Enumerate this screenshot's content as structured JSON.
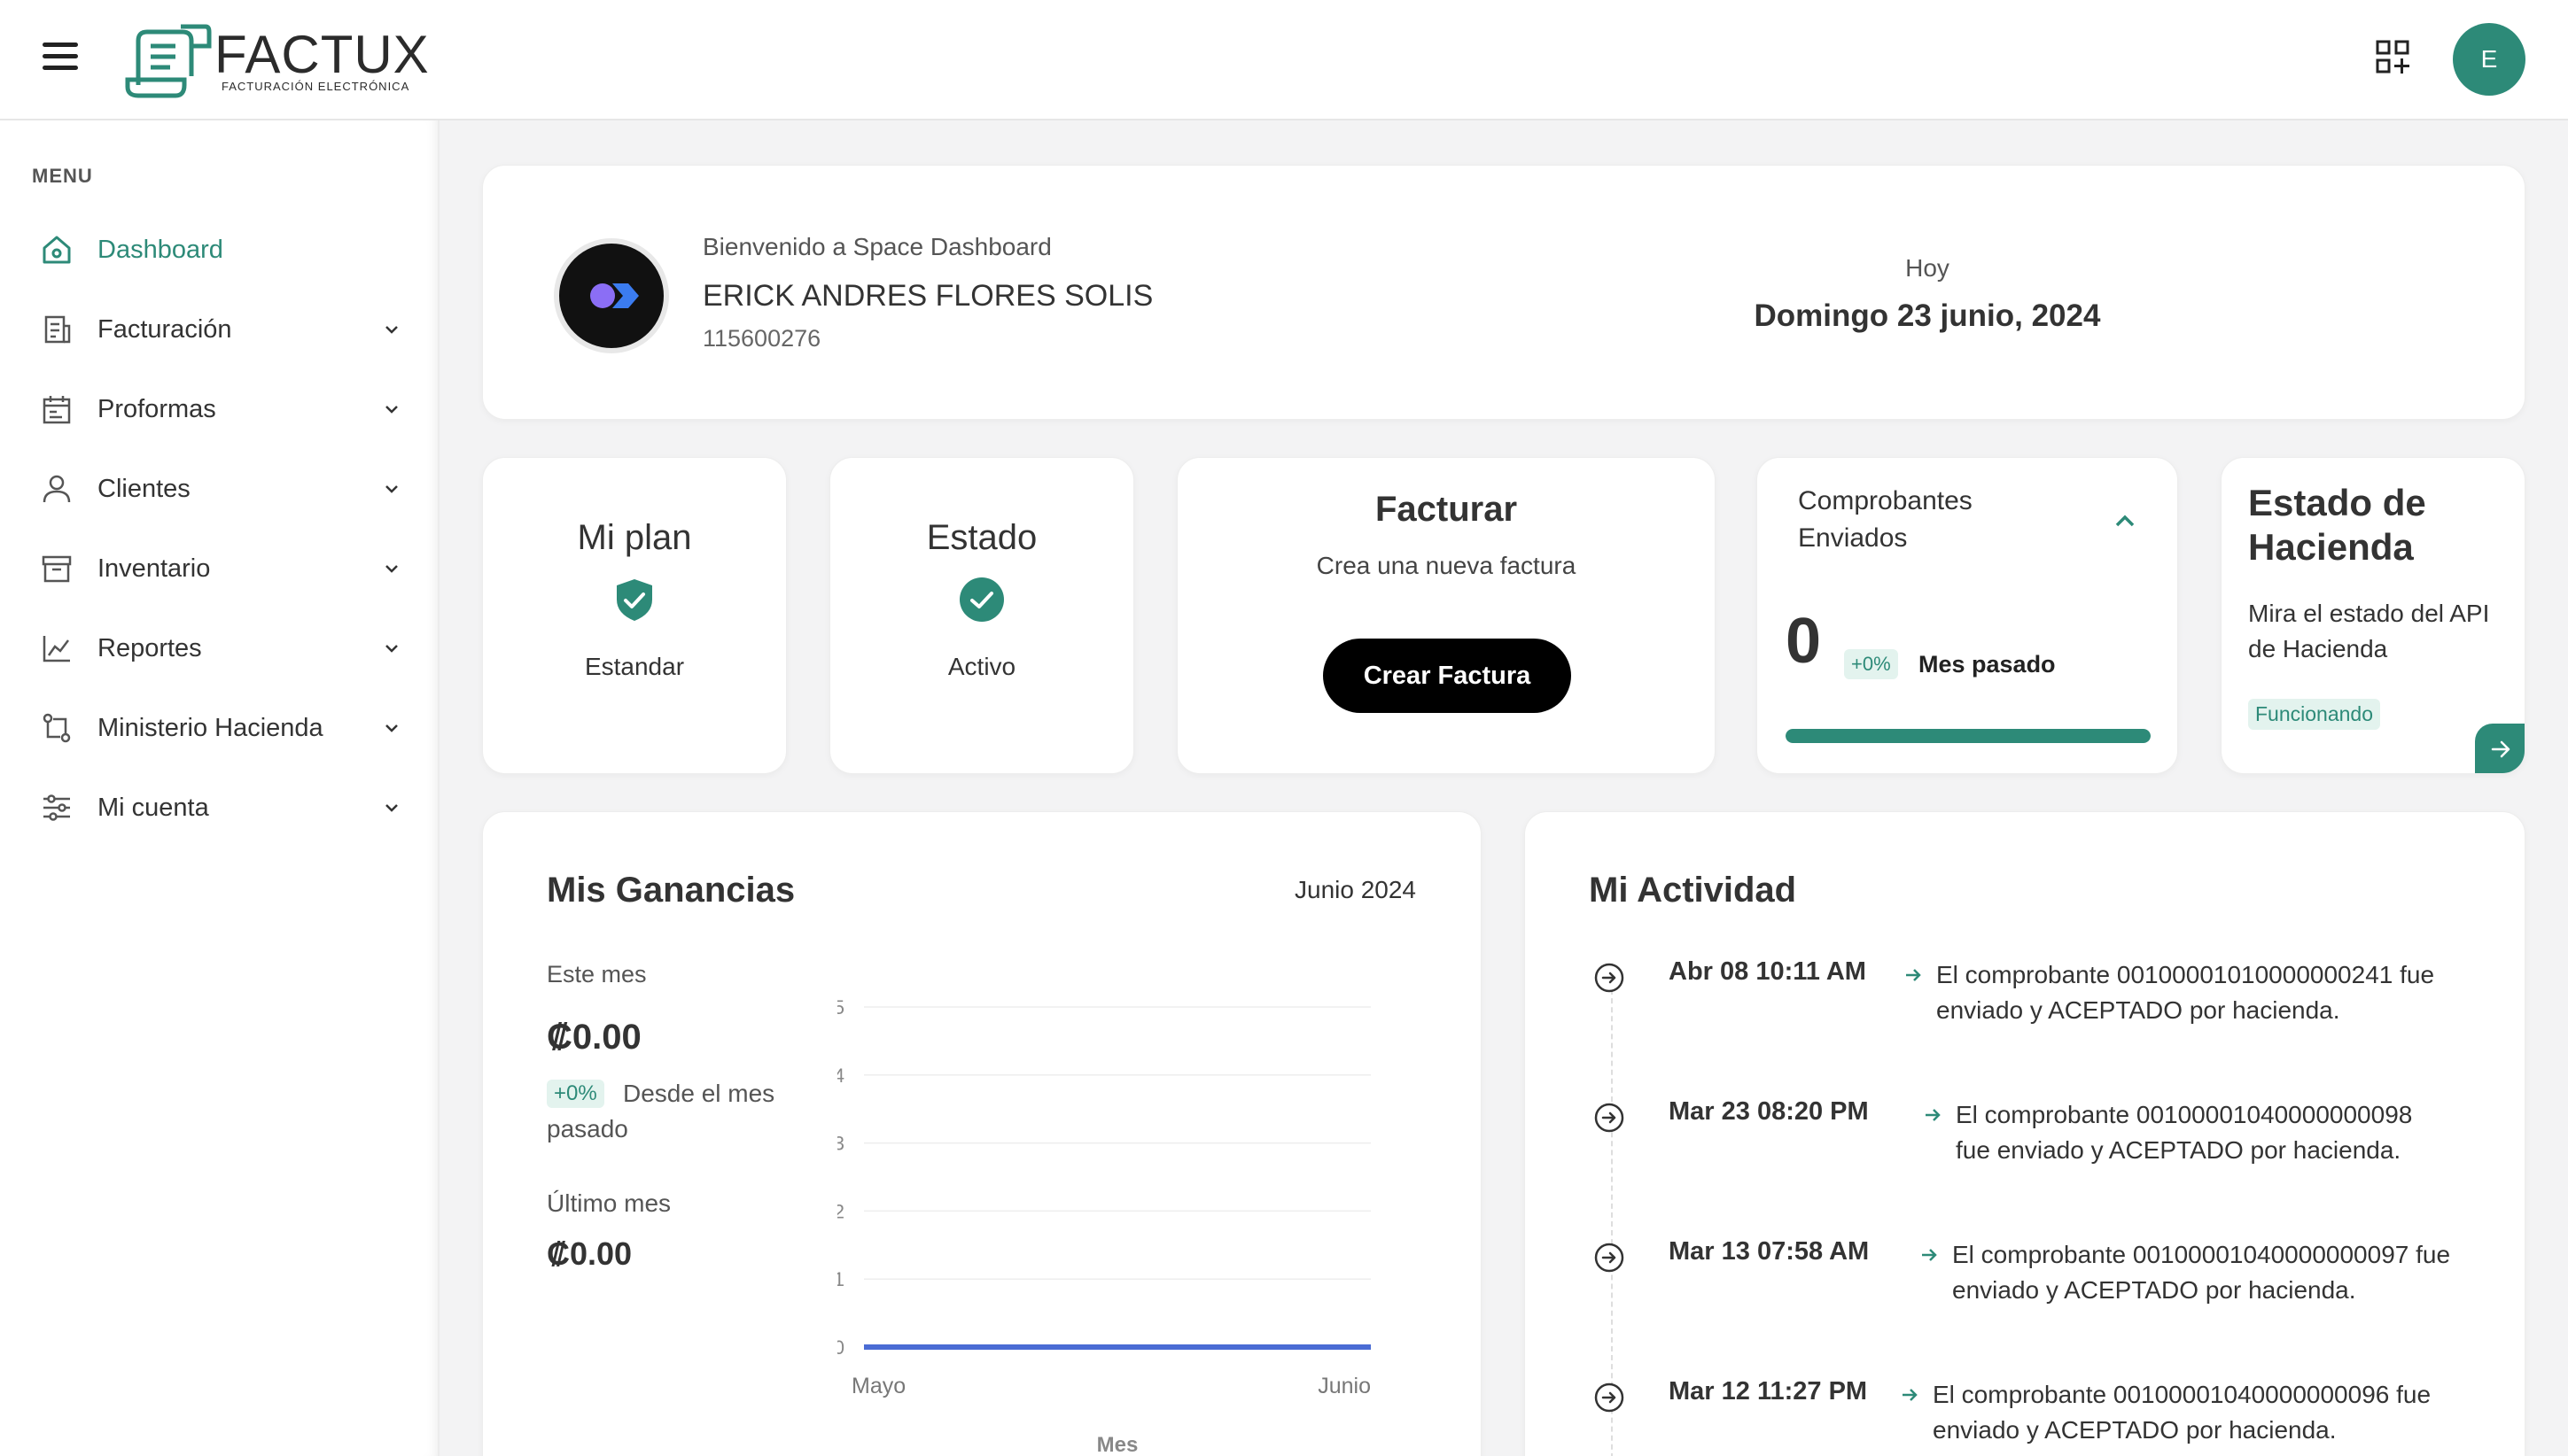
{
  "header": {
    "brand": "FACTUX",
    "brand_sub": "FACTURACIÓN ELECTRÓNICA",
    "avatar_initial": "E"
  },
  "sidebar": {
    "menu_label": "MENU",
    "items": [
      {
        "label": "Dashboard",
        "icon": "home-icon"
      },
      {
        "label": "Facturación",
        "icon": "invoice-icon"
      },
      {
        "label": "Proformas",
        "icon": "calendar-icon"
      },
      {
        "label": "Clientes",
        "icon": "user-icon"
      },
      {
        "label": "Inventario",
        "icon": "archive-icon"
      },
      {
        "label": "Reportes",
        "icon": "chart-line-icon"
      },
      {
        "label": "Ministerio Hacienda",
        "icon": "git-compare-icon"
      },
      {
        "label": "Mi cuenta",
        "icon": "sliders-icon"
      }
    ]
  },
  "welcome": {
    "greeting": "Bienvenido a Space Dashboard",
    "name": "ERICK ANDRES FLORES SOLIS",
    "id": "115600276",
    "today_label": "Hoy",
    "date": "Domingo 23 junio, 2024"
  },
  "plan": {
    "title": "Mi plan",
    "value": "Estandar"
  },
  "estado": {
    "title": "Estado",
    "value": "Activo"
  },
  "facturar": {
    "title": "Facturar",
    "subtitle": "Crea una nueva factura",
    "button": "Crear Factura"
  },
  "comprobantes": {
    "title": "Comprobantes Enviados",
    "count": "0",
    "pct": "+0%",
    "period": "Mes pasado",
    "progress": 1.0
  },
  "hacienda": {
    "title": "Estado de Hacienda",
    "description": "Mira el estado del API de Hacienda",
    "status": "Funcionando"
  },
  "ganancias": {
    "title": "Mis Ganancias",
    "month": "Junio 2024",
    "este_mes_label": "Este mes",
    "este_mes_value": "₡0.00",
    "pct": "+0%",
    "desde": "Desde el mes pasado",
    "ultimo_mes_label": "Último mes",
    "ultimo_mes_value": "₡0.00"
  },
  "chart_data": {
    "type": "line",
    "x": [
      "Mayo",
      "Junio"
    ],
    "series": [
      {
        "values": [
          0,
          0
        ]
      }
    ],
    "xlabel": "Mes",
    "ylabel": "",
    "ylim": [
      0,
      5
    ],
    "yticks": [
      "0",
      "1",
      "2",
      "3",
      "4",
      "5"
    ],
    "grid": true,
    "color": "#4a6cd4"
  },
  "actividad": {
    "title": "Mi Actividad",
    "items": [
      {
        "date": "Abr 08 10:11 AM",
        "text1": "El comprobante 00100001010000000241 fue",
        "text2": "enviado y ACEPTADO por hacienda."
      },
      {
        "date": "Mar 23 08:20 PM",
        "text1": "El comprobante 00100001040000000098",
        "text2": "fue enviado y ACEPTADO por hacienda."
      },
      {
        "date": "Mar 13 07:58 AM",
        "text1": "El comprobante 00100001040000000097 fue",
        "text2": "enviado y ACEPTADO por hacienda."
      },
      {
        "date": "Mar 12 11:27 PM",
        "text1": "El comprobante 00100001040000000096 fue",
        "text2": "enviado y ACEPTADO por hacienda."
      }
    ]
  },
  "colors": {
    "accent": "#2d8a78",
    "chart_line": "#4a6cd4"
  }
}
